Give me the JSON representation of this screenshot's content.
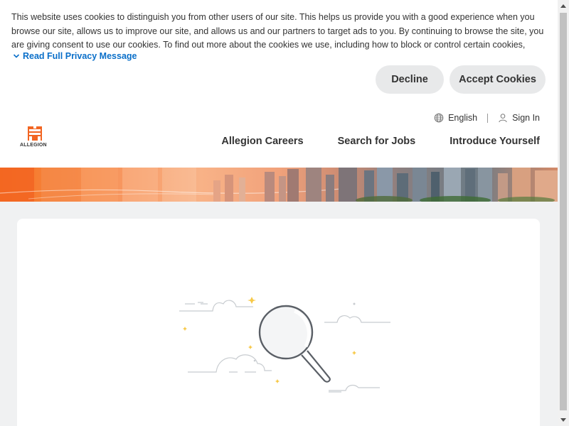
{
  "cookie_banner": {
    "message": "This website uses cookies to distinguish you from other users of our site. This helps us provide you with a good experience when you browse our site, allows us to improve our site, and allows us and our partners to target ads to you. By continuing to browse the site, you are giving consent to use our cookies. To find out more about the cookies we use, including how to block or control certain cookies, please read …",
    "read_more_label": "Read Full Privacy Message",
    "decline_label": "Decline",
    "accept_label": "Accept Cookies"
  },
  "header": {
    "logo_text": "ALLEGION",
    "language_label": "English",
    "signin_label": "Sign In",
    "nav": [
      {
        "label": "Allegion Careers"
      },
      {
        "label": "Search for Jobs"
      },
      {
        "label": "Introduce Yourself"
      }
    ]
  },
  "colors": {
    "brand_orange": "#f26522",
    "link_blue": "#0a6fc9",
    "page_bg": "#f0f1f2"
  },
  "icons": {
    "chevron": "chevron-down-icon",
    "language": "globe-icon",
    "signin": "user-icon",
    "empty_state": "magnifying-glass-illustration"
  }
}
